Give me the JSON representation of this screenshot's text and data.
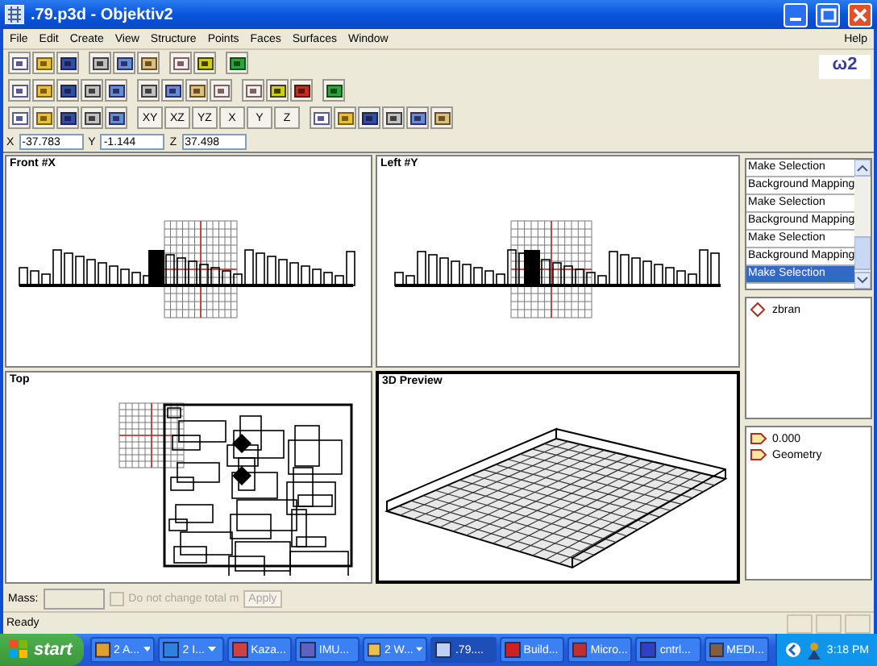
{
  "window": {
    "title": ".79.p3d - Objektiv2"
  },
  "menu": [
    "File",
    "Edit",
    "Create",
    "View",
    "Structure",
    "Points",
    "Faces",
    "Surfaces",
    "Window"
  ],
  "help_menu": "Help",
  "logo": "ω2",
  "axis_buttons": [
    "XY",
    "XZ",
    "YZ",
    "X",
    "Y",
    "Z"
  ],
  "coordinates": [
    {
      "label": "X",
      "value": "-37.783"
    },
    {
      "label": "Y",
      "value": "-1.144"
    },
    {
      "label": "Z",
      "value": "37.498"
    }
  ],
  "viewports": [
    {
      "title": "Front #X",
      "kind": "front",
      "active": false
    },
    {
      "title": "Left #Y",
      "kind": "left",
      "active": false
    },
    {
      "title": "Top",
      "kind": "top",
      "active": false
    },
    {
      "title": "3D Preview",
      "kind": "preview",
      "active": true
    }
  ],
  "history": [
    {
      "label": "Make Selection",
      "selected": false
    },
    {
      "label": "Background Mapping",
      "selected": false
    },
    {
      "label": "Make Selection",
      "selected": false
    },
    {
      "label": "Background Mapping",
      "selected": false
    },
    {
      "label": "Make Selection",
      "selected": false
    },
    {
      "label": "Background Mapping",
      "selected": false
    },
    {
      "label": "Make Selection",
      "selected": true
    }
  ],
  "selections": [
    {
      "label": "zbran"
    }
  ],
  "properties": [
    {
      "label": "0.000"
    },
    {
      "label": "Geometry"
    }
  ],
  "mass": {
    "label": "Mass:",
    "checkbox_label": "Do not change total m",
    "checked": false,
    "disabled": true,
    "apply": "Apply"
  },
  "status_bar": "Ready",
  "taskbar": {
    "start": "start",
    "tasks": [
      {
        "label": "2 A...",
        "selected": false,
        "group": true
      },
      {
        "label": "2 I...",
        "selected": false,
        "group": true
      },
      {
        "label": "Kaza...",
        "selected": false,
        "group": false
      },
      {
        "label": "IMU...",
        "selected": false,
        "group": false
      },
      {
        "label": "2 W...",
        "selected": false,
        "group": true
      },
      {
        "label": ".79....",
        "selected": true,
        "group": false
      },
      {
        "label": "Build...",
        "selected": false,
        "group": false
      },
      {
        "label": "Micro...",
        "selected": false,
        "group": false
      },
      {
        "label": "cntrl...",
        "selected": false,
        "group": false
      },
      {
        "label": "MEDI...",
        "selected": false,
        "group": false
      }
    ],
    "clock": "3:18 PM"
  }
}
